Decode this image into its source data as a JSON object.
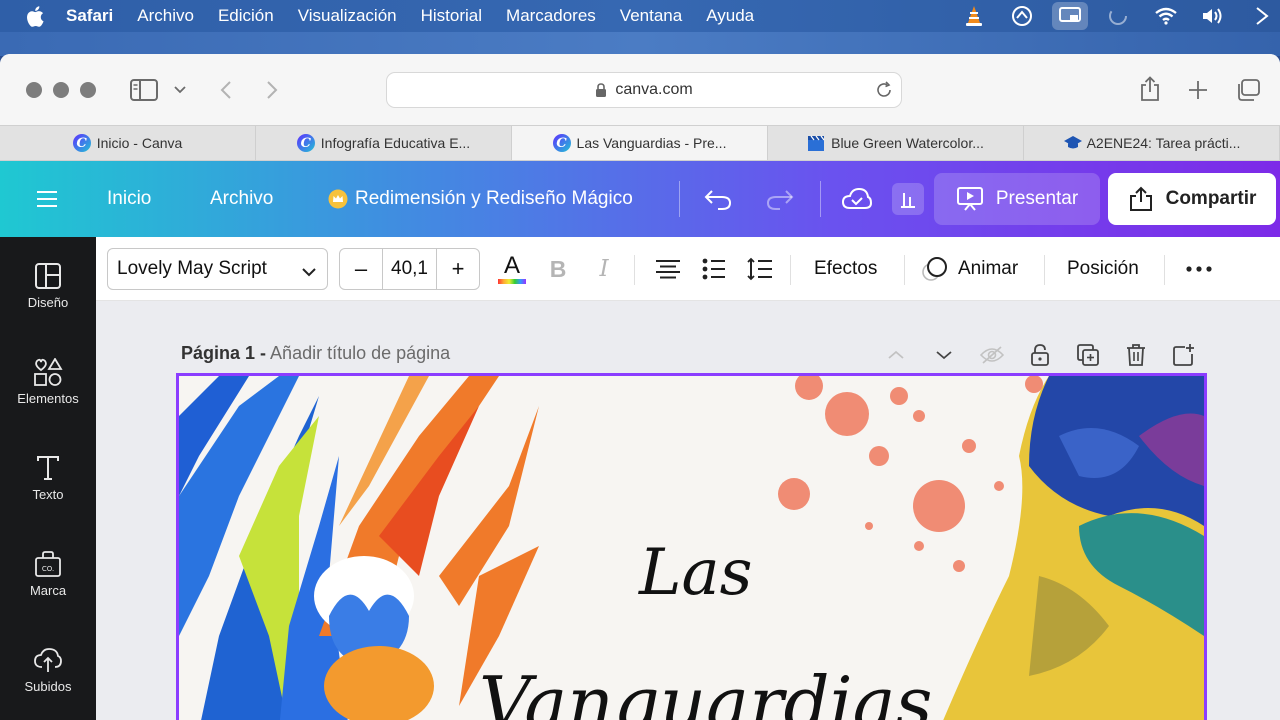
{
  "menubar": {
    "app": "Safari",
    "items": [
      "Archivo",
      "Edición",
      "Visualización",
      "Historial",
      "Marcadores",
      "Ventana",
      "Ayuda"
    ]
  },
  "browser": {
    "url": "canva.com",
    "tabs": [
      {
        "label": "Inicio - Canva",
        "icon": "canva-logo-icon"
      },
      {
        "label": "Infografía Educativa E...",
        "icon": "canva-logo-icon"
      },
      {
        "label": "Las Vanguardias - Pre...",
        "icon": "canva-logo-icon",
        "active": true
      },
      {
        "label": "Blue Green Watercolor...",
        "icon": "clapperboard-icon"
      },
      {
        "label": "A2ENE24: Tarea prácti...",
        "icon": "graduation-cap-icon"
      }
    ]
  },
  "canva_header": {
    "home": "Inicio",
    "file": "Archivo",
    "magic": "Redimensión y Rediseño Mágico",
    "present": "Presentar",
    "share": "Compartir"
  },
  "sidebar": {
    "items": [
      "Diseño",
      "Elementos",
      "Texto",
      "Marca",
      "Subidos"
    ]
  },
  "editbar": {
    "font": "Lovely May Script",
    "size_minus": "–",
    "size": "40,1",
    "size_plus": "+",
    "text_color_glyph": "A",
    "bold_glyph": "B",
    "italic_glyph": "I",
    "effects": "Efectos",
    "animate": "Animar",
    "position": "Posición"
  },
  "canvas": {
    "page_label": "Página 1 -",
    "page_title_placeholder": "Añadir título de página",
    "design_title_line1": "Las",
    "design_title_line2": "Vanguardias"
  },
  "colors": {
    "canva_purple": "#8b3dff",
    "header_start": "#1fc8d2",
    "header_end": "#7d2ae8"
  }
}
